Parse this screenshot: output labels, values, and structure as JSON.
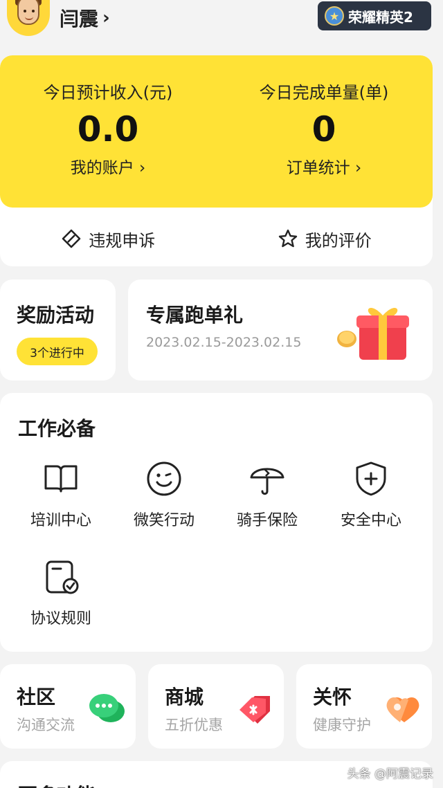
{
  "header": {
    "username": "闫震",
    "rank_badge": "荣耀精英2"
  },
  "income": {
    "left_label": "今日预计收入(元)",
    "left_value": "0.0",
    "left_link": "我的账户",
    "right_label": "今日完成单量(单)",
    "right_value": "0",
    "right_link": "订单统计",
    "actions": [
      {
        "label": "违规申诉",
        "icon": "appeal-icon"
      },
      {
        "label": "我的评价",
        "icon": "star-icon"
      }
    ]
  },
  "reward": {
    "title": "奖励活动",
    "badge": "3个进行中"
  },
  "promo": {
    "title": "专属跑单礼",
    "date": "2023.02.15-2023.02.15"
  },
  "work": {
    "title": "工作必备",
    "tools": [
      {
        "label": "培训中心",
        "icon": "book-icon"
      },
      {
        "label": "微笑行动",
        "icon": "smile-icon"
      },
      {
        "label": "骑手保险",
        "icon": "umbrella-icon"
      },
      {
        "label": "安全中心",
        "icon": "shield-icon"
      },
      {
        "label": "协议规则",
        "icon": "agreement-icon"
      }
    ]
  },
  "quick": [
    {
      "title": "社区",
      "sub": "沟通交流",
      "icon": "chat-icon"
    },
    {
      "title": "商城",
      "sub": "五折优惠",
      "icon": "tag-icon"
    },
    {
      "title": "关怀",
      "sub": "健康守护",
      "icon": "heart-icon"
    }
  ],
  "more": {
    "title": "更多功能"
  },
  "watermark": "头条 @阿震记录",
  "colors": {
    "accent_yellow": "#ffe236",
    "badge_dark": "#2b3443",
    "background": "#f3f3f3"
  }
}
